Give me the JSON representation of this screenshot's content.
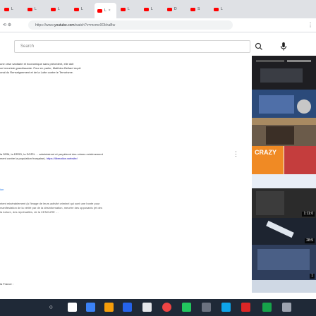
{
  "browser": {
    "tabs": [
      {
        "label": "L"
      },
      {
        "label": "L"
      },
      {
        "label": "L"
      },
      {
        "label": "L"
      },
      {
        "label": "L",
        "close": "×"
      },
      {
        "label": "L"
      },
      {
        "label": "L"
      },
      {
        "label": "D"
      },
      {
        "label": "S"
      },
      {
        "label": "L"
      }
    ],
    "url_host": "youtube.com",
    "url_scheme": "https://www.",
    "url_rest": "/watch?v=mcmc0OkhaBw"
  },
  "youtube": {
    "search_placeholder": "Search"
  },
  "description": {
    "p1_l1": "une crise sanitaire et économique sans précédent, elle doit",
    "p1_l2": "ce terroriste grandissante. Pour en parler, Matthieu Bellard reçoit",
    "p1_l3": "onal du Renseignement et de la Lutte contre le Terrorisme.",
    "p2_l1": "la DRM, la DRSD, la DGPN … administrent et perpètrent des crimes extrêmement",
    "p2_l2": "ment contre la population française).",
    "p2_link": "https://liberation.website/",
    "p3_head": "ion",
    "p3_l1": "ntent misérablement (à l'image de leurs activité criminel qui sont une honte pour",
    "p3_l2": "manifestation de la vérité par de la désinformation, meurtre des opposants (et des",
    "p3_l3": "la torture, des représailles, de la CENCURE …",
    "p4": "la France :"
  },
  "thumbs": {
    "t4_caption": "CRAZY",
    "t5_duration": "1:11:0",
    "t6_duration": "28:5",
    "t7_duration": "1"
  },
  "colors": {
    "youtube_red": "#ff0000",
    "link": "#1a0dab",
    "taskbar": "#1f2937"
  }
}
